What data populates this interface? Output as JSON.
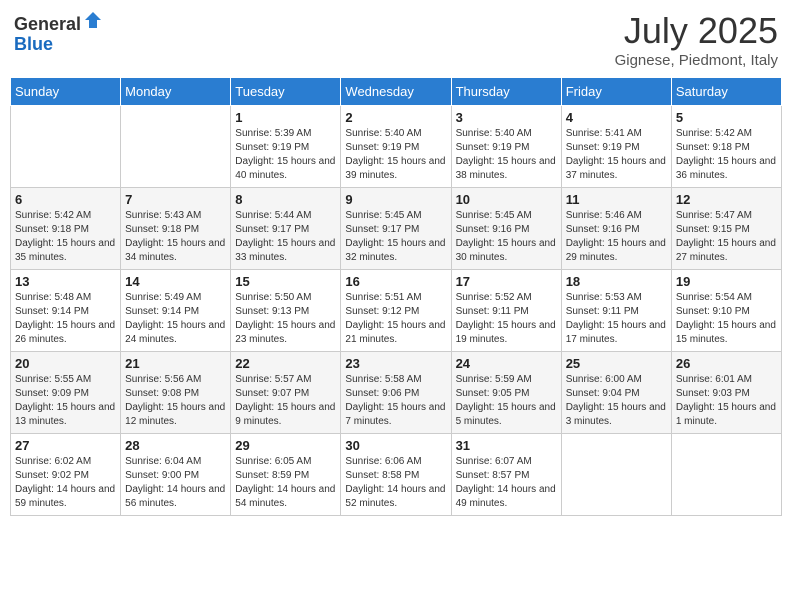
{
  "logo": {
    "general": "General",
    "blue": "Blue"
  },
  "header": {
    "month": "July 2025",
    "location": "Gignese, Piedmont, Italy"
  },
  "weekdays": [
    "Sunday",
    "Monday",
    "Tuesday",
    "Wednesday",
    "Thursday",
    "Friday",
    "Saturday"
  ],
  "weeks": [
    [
      {
        "day": "",
        "sunrise": "",
        "sunset": "",
        "daylight": ""
      },
      {
        "day": "",
        "sunrise": "",
        "sunset": "",
        "daylight": ""
      },
      {
        "day": "1",
        "sunrise": "Sunrise: 5:39 AM",
        "sunset": "Sunset: 9:19 PM",
        "daylight": "Daylight: 15 hours and 40 minutes."
      },
      {
        "day": "2",
        "sunrise": "Sunrise: 5:40 AM",
        "sunset": "Sunset: 9:19 PM",
        "daylight": "Daylight: 15 hours and 39 minutes."
      },
      {
        "day": "3",
        "sunrise": "Sunrise: 5:40 AM",
        "sunset": "Sunset: 9:19 PM",
        "daylight": "Daylight: 15 hours and 38 minutes."
      },
      {
        "day": "4",
        "sunrise": "Sunrise: 5:41 AM",
        "sunset": "Sunset: 9:19 PM",
        "daylight": "Daylight: 15 hours and 37 minutes."
      },
      {
        "day": "5",
        "sunrise": "Sunrise: 5:42 AM",
        "sunset": "Sunset: 9:18 PM",
        "daylight": "Daylight: 15 hours and 36 minutes."
      }
    ],
    [
      {
        "day": "6",
        "sunrise": "Sunrise: 5:42 AM",
        "sunset": "Sunset: 9:18 PM",
        "daylight": "Daylight: 15 hours and 35 minutes."
      },
      {
        "day": "7",
        "sunrise": "Sunrise: 5:43 AM",
        "sunset": "Sunset: 9:18 PM",
        "daylight": "Daylight: 15 hours and 34 minutes."
      },
      {
        "day": "8",
        "sunrise": "Sunrise: 5:44 AM",
        "sunset": "Sunset: 9:17 PM",
        "daylight": "Daylight: 15 hours and 33 minutes."
      },
      {
        "day": "9",
        "sunrise": "Sunrise: 5:45 AM",
        "sunset": "Sunset: 9:17 PM",
        "daylight": "Daylight: 15 hours and 32 minutes."
      },
      {
        "day": "10",
        "sunrise": "Sunrise: 5:45 AM",
        "sunset": "Sunset: 9:16 PM",
        "daylight": "Daylight: 15 hours and 30 minutes."
      },
      {
        "day": "11",
        "sunrise": "Sunrise: 5:46 AM",
        "sunset": "Sunset: 9:16 PM",
        "daylight": "Daylight: 15 hours and 29 minutes."
      },
      {
        "day": "12",
        "sunrise": "Sunrise: 5:47 AM",
        "sunset": "Sunset: 9:15 PM",
        "daylight": "Daylight: 15 hours and 27 minutes."
      }
    ],
    [
      {
        "day": "13",
        "sunrise": "Sunrise: 5:48 AM",
        "sunset": "Sunset: 9:14 PM",
        "daylight": "Daylight: 15 hours and 26 minutes."
      },
      {
        "day": "14",
        "sunrise": "Sunrise: 5:49 AM",
        "sunset": "Sunset: 9:14 PM",
        "daylight": "Daylight: 15 hours and 24 minutes."
      },
      {
        "day": "15",
        "sunrise": "Sunrise: 5:50 AM",
        "sunset": "Sunset: 9:13 PM",
        "daylight": "Daylight: 15 hours and 23 minutes."
      },
      {
        "day": "16",
        "sunrise": "Sunrise: 5:51 AM",
        "sunset": "Sunset: 9:12 PM",
        "daylight": "Daylight: 15 hours and 21 minutes."
      },
      {
        "day": "17",
        "sunrise": "Sunrise: 5:52 AM",
        "sunset": "Sunset: 9:11 PM",
        "daylight": "Daylight: 15 hours and 19 minutes."
      },
      {
        "day": "18",
        "sunrise": "Sunrise: 5:53 AM",
        "sunset": "Sunset: 9:11 PM",
        "daylight": "Daylight: 15 hours and 17 minutes."
      },
      {
        "day": "19",
        "sunrise": "Sunrise: 5:54 AM",
        "sunset": "Sunset: 9:10 PM",
        "daylight": "Daylight: 15 hours and 15 minutes."
      }
    ],
    [
      {
        "day": "20",
        "sunrise": "Sunrise: 5:55 AM",
        "sunset": "Sunset: 9:09 PM",
        "daylight": "Daylight: 15 hours and 13 minutes."
      },
      {
        "day": "21",
        "sunrise": "Sunrise: 5:56 AM",
        "sunset": "Sunset: 9:08 PM",
        "daylight": "Daylight: 15 hours and 12 minutes."
      },
      {
        "day": "22",
        "sunrise": "Sunrise: 5:57 AM",
        "sunset": "Sunset: 9:07 PM",
        "daylight": "Daylight: 15 hours and 9 minutes."
      },
      {
        "day": "23",
        "sunrise": "Sunrise: 5:58 AM",
        "sunset": "Sunset: 9:06 PM",
        "daylight": "Daylight: 15 hours and 7 minutes."
      },
      {
        "day": "24",
        "sunrise": "Sunrise: 5:59 AM",
        "sunset": "Sunset: 9:05 PM",
        "daylight": "Daylight: 15 hours and 5 minutes."
      },
      {
        "day": "25",
        "sunrise": "Sunrise: 6:00 AM",
        "sunset": "Sunset: 9:04 PM",
        "daylight": "Daylight: 15 hours and 3 minutes."
      },
      {
        "day": "26",
        "sunrise": "Sunrise: 6:01 AM",
        "sunset": "Sunset: 9:03 PM",
        "daylight": "Daylight: 15 hours and 1 minute."
      }
    ],
    [
      {
        "day": "27",
        "sunrise": "Sunrise: 6:02 AM",
        "sunset": "Sunset: 9:02 PM",
        "daylight": "Daylight: 14 hours and 59 minutes."
      },
      {
        "day": "28",
        "sunrise": "Sunrise: 6:04 AM",
        "sunset": "Sunset: 9:00 PM",
        "daylight": "Daylight: 14 hours and 56 minutes."
      },
      {
        "day": "29",
        "sunrise": "Sunrise: 6:05 AM",
        "sunset": "Sunset: 8:59 PM",
        "daylight": "Daylight: 14 hours and 54 minutes."
      },
      {
        "day": "30",
        "sunrise": "Sunrise: 6:06 AM",
        "sunset": "Sunset: 8:58 PM",
        "daylight": "Daylight: 14 hours and 52 minutes."
      },
      {
        "day": "31",
        "sunrise": "Sunrise: 6:07 AM",
        "sunset": "Sunset: 8:57 PM",
        "daylight": "Daylight: 14 hours and 49 minutes."
      },
      {
        "day": "",
        "sunrise": "",
        "sunset": "",
        "daylight": ""
      },
      {
        "day": "",
        "sunrise": "",
        "sunset": "",
        "daylight": ""
      }
    ]
  ]
}
